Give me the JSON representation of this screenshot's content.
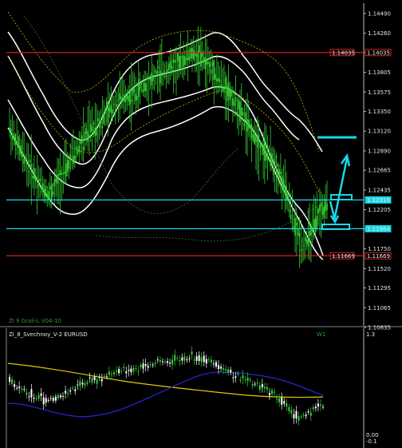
{
  "chart_data": {
    "type": "line",
    "price_axis": {
      "ticks": [
        "1.14490",
        "1.14260",
        "1.14035",
        "1.13805",
        "1.13575",
        "1.13350",
        "1.13120",
        "1.12890",
        "1.12665",
        "1.12435",
        "1.12205",
        "1.11980",
        "1.11750",
        "1.11520",
        "1.11295",
        "1.11065",
        "1.10835"
      ],
      "range": [
        1.10835,
        1.146
      ]
    },
    "horizontal_lines": [
      {
        "price": 1.14035,
        "label": "1.14035",
        "color": "#d22020"
      },
      {
        "price": 1.12319,
        "label": "1.12319",
        "color": "#19d7e6"
      },
      {
        "price": 1.11984,
        "label": "1.11984",
        "color": "#19d7e6"
      },
      {
        "price": 1.11669,
        "label": "1.11669",
        "color": "#d22020"
      }
    ],
    "candles_close": [
      1.1317,
      1.1296,
      1.1278,
      1.1262,
      1.1249,
      1.1238,
      1.1251,
      1.1267,
      1.1283,
      1.1298,
      1.1311,
      1.132,
      1.133,
      1.1342,
      1.135,
      1.1353,
      1.1357,
      1.1367,
      1.1372,
      1.138,
      1.1384,
      1.1388,
      1.1396,
      1.1402,
      1.14,
      1.139,
      1.1378,
      1.1365,
      1.1351,
      1.1335,
      1.1318,
      1.1303,
      1.129,
      1.128,
      1.1262,
      1.1235,
      1.1198,
      1.1178,
      1.1193,
      1.1216,
      1.1226
    ],
    "main_indicator_label": "Zi 9 Grail-L V04-10",
    "sub_indicator": {
      "title": "Zi_8_Svechnoy_V-2 EURUSD",
      "timeframe": "W1",
      "scale_top": "1.3",
      "scale_bottom": "0.00",
      "scale_bottom2": "-0.1"
    },
    "colors": {
      "background": "#000000",
      "candles": "#32d232",
      "band": "#ffffff",
      "sub_yellow": "#e6c800",
      "sub_blue": "#2828d2"
    },
    "grid": false
  }
}
